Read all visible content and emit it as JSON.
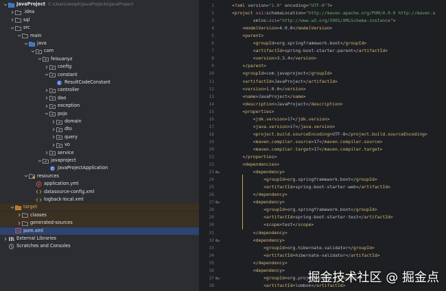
{
  "project_tree": {
    "rows": [
      {
        "depth": 0,
        "chev": "down",
        "icon": "folder-blue",
        "label": "JavaProject",
        "bold": true,
        "path": "C:\\Users\\weiph\\JavaProjects\\JavaProject"
      },
      {
        "depth": 1,
        "chev": "right",
        "icon": "folder",
        "label": ".idea"
      },
      {
        "depth": 1,
        "chev": "right",
        "icon": "folder",
        "label": "sql"
      },
      {
        "depth": 1,
        "chev": "down",
        "icon": "folder",
        "label": "src"
      },
      {
        "depth": 2,
        "chev": "down",
        "icon": "folder",
        "label": "main"
      },
      {
        "depth": 3,
        "chev": "down",
        "icon": "folder-blue",
        "label": "java"
      },
      {
        "depth": 4,
        "chev": "down",
        "icon": "package",
        "label": "com"
      },
      {
        "depth": 5,
        "chev": "down",
        "icon": "package",
        "label": "feisuanyz"
      },
      {
        "depth": 6,
        "chev": "right",
        "icon": "package",
        "label": "config"
      },
      {
        "depth": 6,
        "chev": "down",
        "icon": "package",
        "label": "constant"
      },
      {
        "depth": 7,
        "chev": "none",
        "icon": "java-class",
        "label": "ResultCodeConstant"
      },
      {
        "depth": 6,
        "chev": "right",
        "icon": "package",
        "label": "controller"
      },
      {
        "depth": 6,
        "chev": "right",
        "icon": "package",
        "label": "dao"
      },
      {
        "depth": 6,
        "chev": "right",
        "icon": "package",
        "label": "exception"
      },
      {
        "depth": 6,
        "chev": "down",
        "icon": "package",
        "label": "pojo"
      },
      {
        "depth": 7,
        "chev": "right",
        "icon": "package",
        "label": "domain"
      },
      {
        "depth": 7,
        "chev": "right",
        "icon": "package",
        "label": "dto"
      },
      {
        "depth": 7,
        "chev": "right",
        "icon": "package",
        "label": "query"
      },
      {
        "depth": 7,
        "chev": "right",
        "icon": "package",
        "label": "vo"
      },
      {
        "depth": 6,
        "chev": "right",
        "icon": "package",
        "label": "service"
      },
      {
        "depth": 5,
        "chev": "down",
        "icon": "package",
        "label": "javaproject"
      },
      {
        "depth": 6,
        "chev": "none",
        "icon": "java-class",
        "label": "JavaProjectApplication"
      },
      {
        "depth": 3,
        "chev": "down",
        "icon": "folder-res",
        "label": "resources"
      },
      {
        "depth": 4,
        "chev": "none",
        "icon": "yml",
        "label": "application.yml"
      },
      {
        "depth": 4,
        "chev": "none",
        "icon": "xml",
        "label": "datasource-config.xml"
      },
      {
        "depth": 4,
        "chev": "none",
        "icon": "xml",
        "label": "logback-local.xml"
      },
      {
        "depth": 1,
        "chev": "down",
        "icon": "folder-orange",
        "label": "target",
        "row_style": "target"
      },
      {
        "depth": 2,
        "chev": "right",
        "icon": "folder",
        "label": "classes",
        "row_style": "target"
      },
      {
        "depth": 2,
        "chev": "right",
        "icon": "folder",
        "label": "generated-sources",
        "row_style": "target"
      },
      {
        "depth": 1,
        "chev": "none",
        "icon": "maven",
        "label": "pom.xml",
        "row_style": "selected"
      },
      {
        "depth": 0,
        "chev": "right",
        "icon": "library",
        "label": "External Libraries"
      },
      {
        "depth": 0,
        "chev": "none",
        "icon": "scratch",
        "label": "Scratches and Consoles"
      }
    ]
  },
  "editor": {
    "line_numbers": [
      "1",
      "2",
      "3",
      "4",
      "5",
      "6",
      "7",
      "8",
      "9",
      "10",
      "11",
      "12",
      "13",
      "14",
      "15",
      "16",
      "17",
      "18",
      "19",
      "20",
      "21",
      "22",
      "23",
      "24",
      "25",
      "26",
      "27",
      "28",
      "29",
      "30",
      "31",
      "32",
      "33",
      "34",
      "35",
      "36",
      "37",
      "38"
    ],
    "gutter_marks": {
      "23": "⚙↙",
      "27": "⚙↙",
      "32": "⚙↙",
      "37": "⚙↙"
    },
    "lines": [
      [
        [
          "t-punct",
          "<?"
        ],
        [
          "t-tag",
          "xml "
        ],
        [
          "t-attr",
          "version="
        ],
        [
          "t-val",
          "\"1.0\" "
        ],
        [
          "t-attr",
          "encoding="
        ],
        [
          "t-val",
          "\"UTF-8\""
        ],
        [
          "t-punct",
          "?>"
        ]
      ],
      [
        [
          "t-punct",
          "<"
        ],
        [
          "t-tag",
          "project "
        ],
        [
          "t-ns",
          "xsi"
        ],
        [
          "t-attr",
          ":schemaLocation="
        ],
        [
          "t-val",
          "\"http://maven.apache.org/POM/4.0.0 http://maven.a"
        ]
      ],
      [
        [
          "t-attr",
          "        xmlns:"
        ],
        [
          "t-ns",
          "xsi"
        ],
        [
          "t-attr",
          "="
        ],
        [
          "t-val",
          "\"http://www.w3.org/2001/XMLSchema-instance\""
        ],
        [
          "t-punct",
          ">"
        ]
      ],
      [
        [
          "t-punct",
          "    <"
        ],
        [
          "t-tag",
          "modelVersion"
        ],
        [
          "t-punct",
          ">"
        ],
        [
          "t-text",
          "4.0.0"
        ],
        [
          "t-punct",
          "</"
        ],
        [
          "t-tag",
          "modelVersion"
        ],
        [
          "t-punct",
          ">"
        ]
      ],
      [
        [
          "t-punct",
          "    <"
        ],
        [
          "t-tag",
          "parent"
        ],
        [
          "t-punct",
          ">"
        ]
      ],
      [
        [
          "t-punct",
          "        <"
        ],
        [
          "t-tag",
          "groupId"
        ],
        [
          "t-punct",
          ">"
        ],
        [
          "t-text",
          "org.springframework.boot"
        ],
        [
          "t-punct",
          "</"
        ],
        [
          "t-tag",
          "groupId"
        ],
        [
          "t-punct",
          ">"
        ]
      ],
      [
        [
          "t-punct",
          "        <"
        ],
        [
          "t-tag",
          "artifactId"
        ],
        [
          "t-punct",
          ">"
        ],
        [
          "t-text",
          "spring-boot-starter-parent"
        ],
        [
          "t-punct",
          "</"
        ],
        [
          "t-tag",
          "artifactId"
        ],
        [
          "t-punct",
          ">"
        ]
      ],
      [
        [
          "t-punct",
          "        <"
        ],
        [
          "t-tag",
          "version"
        ],
        [
          "t-punct",
          ">"
        ],
        [
          "t-text",
          "3.3.4"
        ],
        [
          "t-punct",
          "</"
        ],
        [
          "t-tag",
          "version"
        ],
        [
          "t-punct",
          ">"
        ]
      ],
      [
        [
          "t-punct",
          "    </"
        ],
        [
          "t-tag",
          "parent"
        ],
        [
          "t-punct",
          ">"
        ]
      ],
      [
        [
          "t-punct",
          "    <"
        ],
        [
          "t-tag",
          "groupId"
        ],
        [
          "t-punct",
          ">"
        ],
        [
          "t-text",
          "com.javaproject"
        ],
        [
          "t-punct",
          "</"
        ],
        [
          "t-tag",
          "groupId"
        ],
        [
          "t-punct",
          ">"
        ]
      ],
      [
        [
          "t-punct",
          "    <"
        ],
        [
          "t-tag",
          "artifactId"
        ],
        [
          "t-punct",
          ">"
        ],
        [
          "t-text",
          "JavaProject"
        ],
        [
          "t-punct",
          "</"
        ],
        [
          "t-tag",
          "artifactId"
        ],
        [
          "t-punct",
          ">"
        ]
      ],
      [
        [
          "t-punct",
          "    <"
        ],
        [
          "t-tag",
          "version"
        ],
        [
          "t-punct",
          ">"
        ],
        [
          "t-text",
          "1.0.0"
        ],
        [
          "t-punct",
          "</"
        ],
        [
          "t-tag",
          "version"
        ],
        [
          "t-punct",
          ">"
        ]
      ],
      [
        [
          "t-punct",
          "    <"
        ],
        [
          "t-tag",
          "name"
        ],
        [
          "t-punct",
          ">"
        ],
        [
          "t-text",
          "JavaProject"
        ],
        [
          "t-punct",
          "</"
        ],
        [
          "t-tag",
          "name"
        ],
        [
          "t-punct",
          ">"
        ]
      ],
      [
        [
          "t-punct",
          "    <"
        ],
        [
          "t-tag",
          "description"
        ],
        [
          "t-punct",
          ">"
        ],
        [
          "t-text",
          "JavaProject"
        ],
        [
          "t-punct",
          "</"
        ],
        [
          "t-tag",
          "description"
        ],
        [
          "t-punct",
          ">"
        ]
      ],
      [
        [
          "t-punct",
          "    <"
        ],
        [
          "t-tag",
          "properties"
        ],
        [
          "t-punct",
          ">"
        ]
      ],
      [
        [
          "t-punct",
          "        <"
        ],
        [
          "t-tag",
          "jdk.version"
        ],
        [
          "t-punct",
          ">"
        ],
        [
          "t-text",
          "17"
        ],
        [
          "t-punct",
          "</"
        ],
        [
          "t-tag",
          "jdk.version"
        ],
        [
          "t-punct",
          ">"
        ]
      ],
      [
        [
          "t-punct",
          "        <"
        ],
        [
          "t-tag",
          "java.version"
        ],
        [
          "t-punct",
          ">"
        ],
        [
          "t-text",
          "17"
        ],
        [
          "t-punct",
          "</"
        ],
        [
          "t-tag",
          "java.version"
        ],
        [
          "t-punct",
          ">"
        ]
      ],
      [
        [
          "t-punct",
          "        <"
        ],
        [
          "t-tag",
          "project.build.sourceEncoding"
        ],
        [
          "t-punct",
          ">"
        ],
        [
          "t-text",
          "UTF-8"
        ],
        [
          "t-punct",
          "</"
        ],
        [
          "t-tag",
          "project.build.sourceEncoding"
        ],
        [
          "t-punct",
          ">"
        ]
      ],
      [
        [
          "t-punct",
          "        <"
        ],
        [
          "t-tag",
          "maven.compiler.source"
        ],
        [
          "t-punct",
          ">"
        ],
        [
          "t-text",
          "17"
        ],
        [
          "t-punct",
          "</"
        ],
        [
          "t-tag",
          "maven.compiler.source"
        ],
        [
          "t-punct",
          ">"
        ]
      ],
      [
        [
          "t-punct",
          "        <"
        ],
        [
          "t-tag",
          "maven.compiler.target"
        ],
        [
          "t-punct",
          ">"
        ],
        [
          "t-text",
          "17"
        ],
        [
          "t-punct",
          "</"
        ],
        [
          "t-tag",
          "maven.compiler.target"
        ],
        [
          "t-punct",
          ">"
        ]
      ],
      [
        [
          "t-punct",
          "    </"
        ],
        [
          "t-tag",
          "properties"
        ],
        [
          "t-punct",
          ">"
        ]
      ],
      [
        [
          "t-punct",
          "    <"
        ],
        [
          "t-tag",
          "dependencies"
        ],
        [
          "t-punct",
          ">"
        ]
      ],
      [
        [
          "t-punct",
          "        <"
        ],
        [
          "t-tag",
          "dependency"
        ],
        [
          "t-punct",
          ">"
        ]
      ],
      [
        [
          "t-punct",
          "            <"
        ],
        [
          "t-tag",
          "groupId"
        ],
        [
          "t-punct",
          ">"
        ],
        [
          "t-text",
          "org.springframework.boot"
        ],
        [
          "t-punct",
          "</"
        ],
        [
          "t-tag",
          "groupId"
        ],
        [
          "t-punct",
          ">"
        ]
      ],
      [
        [
          "t-punct",
          "            <"
        ],
        [
          "t-tag",
          "artifactId"
        ],
        [
          "t-punct",
          ">"
        ],
        [
          "t-text",
          "spring-boot-starter-web"
        ],
        [
          "t-punct",
          "</"
        ],
        [
          "t-tag",
          "artifactId"
        ],
        [
          "t-punct",
          ">"
        ]
      ],
      [
        [
          "t-punct",
          "        </"
        ],
        [
          "t-tag",
          "dependency"
        ],
        [
          "t-punct",
          ">"
        ]
      ],
      [
        [
          "t-punct",
          "        <"
        ],
        [
          "t-tag",
          "dependency"
        ],
        [
          "t-punct",
          ">"
        ]
      ],
      [
        [
          "t-punct",
          "            <"
        ],
        [
          "t-tag",
          "groupId"
        ],
        [
          "t-punct",
          ">"
        ],
        [
          "t-text",
          "org.springframework.boot"
        ],
        [
          "t-punct",
          "</"
        ],
        [
          "t-tag",
          "groupId"
        ],
        [
          "t-punct",
          ">"
        ]
      ],
      [
        [
          "t-punct",
          "            <"
        ],
        [
          "t-tag",
          "artifactId"
        ],
        [
          "t-punct",
          ">"
        ],
        [
          "t-text",
          "spring-boot-starter-test"
        ],
        [
          "t-punct",
          "</"
        ],
        [
          "t-tag",
          "artifactId"
        ],
        [
          "t-punct",
          ">"
        ]
      ],
      [
        [
          "t-punct",
          "            <"
        ],
        [
          "t-tag",
          "scope"
        ],
        [
          "t-punct",
          ">"
        ],
        [
          "t-text",
          "test"
        ],
        [
          "t-punct",
          "</"
        ],
        [
          "t-tag",
          "scope"
        ],
        [
          "t-punct",
          ">"
        ]
      ],
      [
        [
          "t-punct",
          "        </"
        ],
        [
          "t-tag",
          "dependency"
        ],
        [
          "t-punct",
          ">"
        ]
      ],
      [
        [
          "t-punct",
          "        <"
        ],
        [
          "t-tag",
          "dependency"
        ],
        [
          "t-punct",
          ">"
        ]
      ],
      [
        [
          "t-punct",
          "            <"
        ],
        [
          "t-tag",
          "groupId"
        ],
        [
          "t-punct",
          ">"
        ],
        [
          "t-text",
          "org.hibernate.validator"
        ],
        [
          "t-punct",
          "</"
        ],
        [
          "t-tag",
          "groupId"
        ],
        [
          "t-punct",
          ">"
        ]
      ],
      [
        [
          "t-punct",
          "            <"
        ],
        [
          "t-tag",
          "artifactId"
        ],
        [
          "t-punct",
          ">"
        ],
        [
          "t-text",
          "hibernate-validator"
        ],
        [
          "t-punct",
          "</"
        ],
        [
          "t-tag",
          "artifactId"
        ],
        [
          "t-punct",
          ">"
        ]
      ],
      [
        [
          "t-punct",
          "        </"
        ],
        [
          "t-tag",
          "dependency"
        ],
        [
          "t-punct",
          ">"
        ]
      ],
      [
        [
          "t-punct",
          "        <"
        ],
        [
          "t-tag",
          "dependency"
        ],
        [
          "t-punct",
          ">"
        ]
      ],
      [
        [
          "t-punct",
          "            <"
        ],
        [
          "t-tag",
          "groupId"
        ],
        [
          "t-punct",
          ">"
        ],
        [
          "t-text",
          "org.projectlombok"
        ],
        [
          "t-punct",
          "</"
        ],
        [
          "t-tag",
          "groupId"
        ],
        [
          "t-punct",
          ">"
        ]
      ],
      [
        [
          "t-punct",
          "            <"
        ],
        [
          "t-tag",
          "artifactId"
        ],
        [
          "t-punct",
          ">"
        ],
        [
          "t-text",
          "lombok"
        ],
        [
          "t-punct",
          "</"
        ],
        [
          "t-tag",
          "artifactId"
        ],
        [
          "t-punct",
          ">"
        ]
      ]
    ]
  },
  "watermark": "掘金技术社区 @ 掘金点",
  "colors": {
    "tree_bg": "#2b2d30",
    "editor_bg": "#1e1f22",
    "selected_row": "#2e436e",
    "target_row": "#3b3022",
    "xml_tag": "#d5b778",
    "xml_value": "#6aab73",
    "xml_namespace": "#c77dbb",
    "indent_guide": "#c9a44a"
  }
}
